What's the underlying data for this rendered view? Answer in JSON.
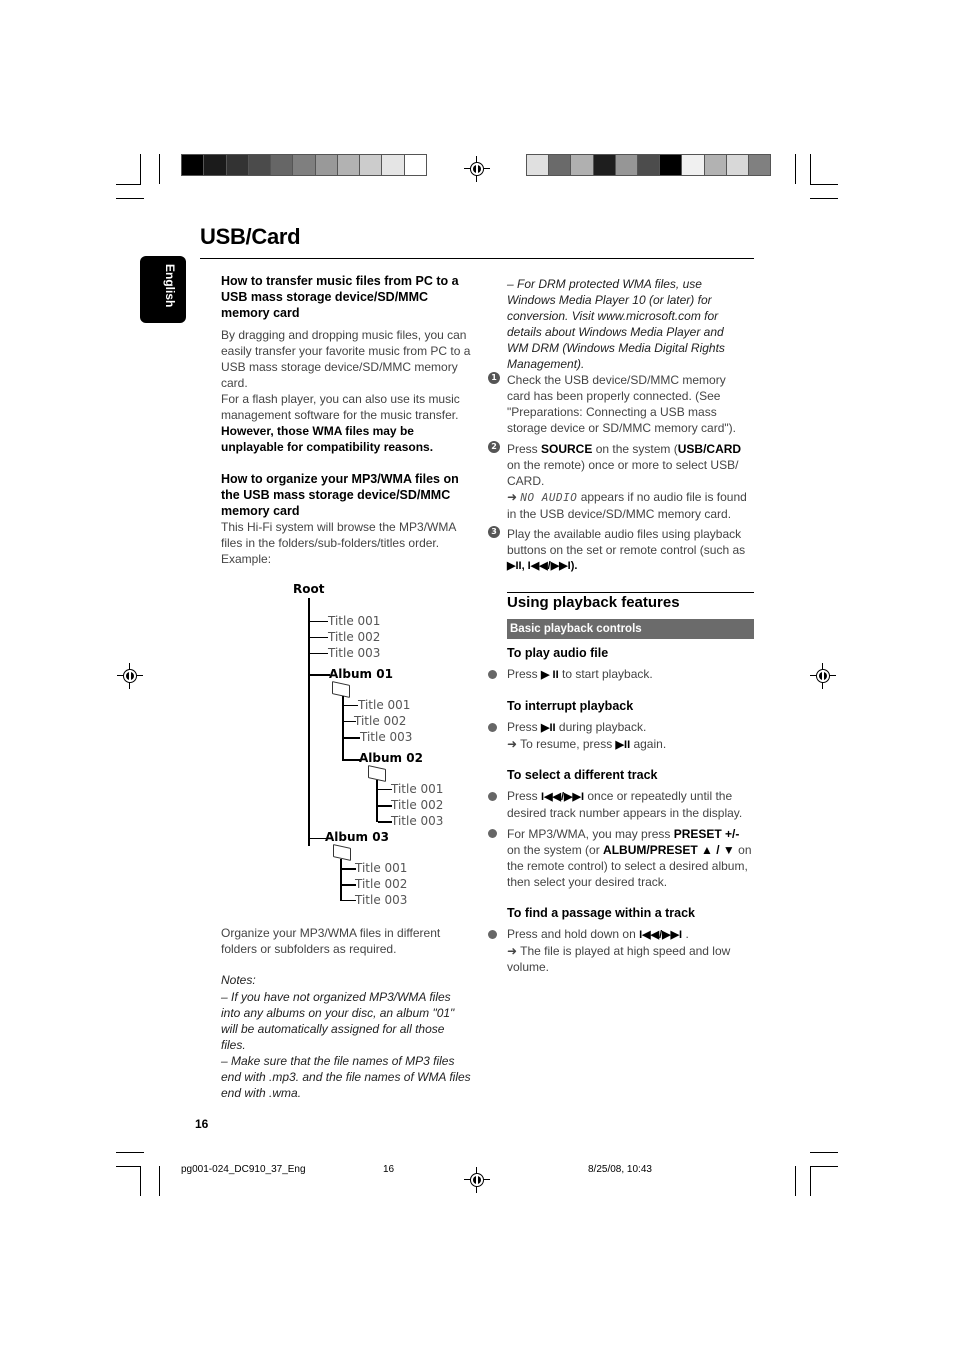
{
  "page": {
    "title": "USB/Card",
    "language_tab": "English",
    "page_number": "16"
  },
  "colorbars": {
    "left": [
      "#000000",
      "#1b1b1b",
      "#333333",
      "#4b4b4b",
      "#666666",
      "#7f7f7f",
      "#999999",
      "#b2b2b2",
      "#cccccc",
      "#e5e5e5",
      "#ffffff"
    ],
    "right": [
      "#e0e0e0",
      "#6a6a6a",
      "#b0b0b0",
      "#1e1e1e",
      "#969696",
      "#4c4c4c",
      "#000000",
      "#f0f0f0",
      "#b2b2b2",
      "#d8d8d8",
      "#808080"
    ]
  },
  "left_column": {
    "transfer_heading": "How to transfer music files from PC to a USB mass storage device/SD/MMC memory card",
    "transfer_body": "By dragging and dropping music files, you can easily transfer your favorite music from PC to a USB mass storage device/SD/MMC memory card.",
    "flash_body": "For a flash player, you can also use its music management software for the music transfer.",
    "wma_warning": "However, those WMA files may be unplayable for compatibility reasons.",
    "organize_heading": "How to organize your MP3/WMA files on the USB mass storage device/SD/MMC memory card",
    "organize_body": "This Hi-Fi system will browse the MP3/WMA files in the folders/sub-folders/titles order.",
    "example_label": "Example:",
    "tree": {
      "root": "Root",
      "root_titles": [
        "Title 001",
        "Title 002",
        "Title 003"
      ],
      "album01": "Album 01",
      "album01_titles": [
        "Title 001",
        "Title 002",
        "Title 003"
      ],
      "album02": "Album 02",
      "album02_titles": [
        "Title 001",
        "Title 002",
        "Title 003"
      ],
      "album03": "Album 03",
      "album03_titles": [
        "Title 001",
        "Title 002",
        "Title 003"
      ]
    },
    "organize_tip": "Organize your MP3/WMA files in different folders or subfolders as required.",
    "notes_label": "Notes:",
    "notes": [
      "–  If you have not organized MP3/WMA files into any albums on your disc, an album \"01\" will be automatically assigned for all those files.",
      "–  Make sure that the file names of MP3 files end with .mp3. and the file names of WMA files end with .wma."
    ]
  },
  "right_column": {
    "drm_note": "–  For DRM protected WMA files, use Windows Media Player 10 (or later) for conversion. Visit www.microsoft.com for details about Windows Media Player and WM DRM (Windows Media Digital Rights Management).",
    "steps": [
      {
        "num": "1",
        "text": "Check the USB device/SD/MMC memory card has been properly connected. (See \"Preparations: Connecting a USB mass storage device or SD/MMC memory card\")."
      },
      {
        "num": "2",
        "pre": "Press ",
        "bold1": "SOURCE",
        "mid": " on the system (",
        "bold2": "USB/CARD",
        "post": " on the remote) once or more to select USB/ CARD.",
        "arrow": "➜ ",
        "lcd": "NO AUDIO",
        "arrow_post": " appears if no audio file is found in the USB device/SD/MMC memory card."
      },
      {
        "num": "3",
        "text": "Play the available audio files using playback buttons on the set or remote control (such as",
        "keys": "▶II,  I◀◀/▶▶I)."
      }
    ],
    "section_title": "Using playback features",
    "subsection_title": "Basic playback controls",
    "play": {
      "heading": "To play audio file",
      "pre": "Press ",
      "key": "▶ II",
      "post": " to start playback."
    },
    "interrupt": {
      "heading": "To interrupt playback",
      "pre": "Press ",
      "key": "▶II",
      "post": " during playback.",
      "resume_pre": "➜ To resume, press ",
      "resume_key": "▶II",
      "resume_post": " again."
    },
    "select": {
      "heading": "To select a different track",
      "b1_pre": "Press ",
      "b1_key": "I◀◀/▶▶I",
      "b1_post": " once or repeatedly until the desired track number appears in the display.",
      "b2_pre": "For MP3/WMA, you may press ",
      "b2_bold1": "PRESET +/-",
      "b2_mid": " on the system (or ",
      "b2_bold2": "ALBUM/PRESET ▲ / ▼",
      "b2_post": " on the remote control) to select a desired album, then select your desired track."
    },
    "find": {
      "heading": "To find a passage within a track",
      "pre": "Press and hold down on ",
      "key": "I◀◀/▶▶I",
      "post": " .",
      "result": "➜ The file is played at high speed and low volume."
    }
  },
  "footer": {
    "filename": "pg001-024_DC910_37_Eng",
    "page": "16",
    "timestamp": "8/25/08, 10:43"
  }
}
